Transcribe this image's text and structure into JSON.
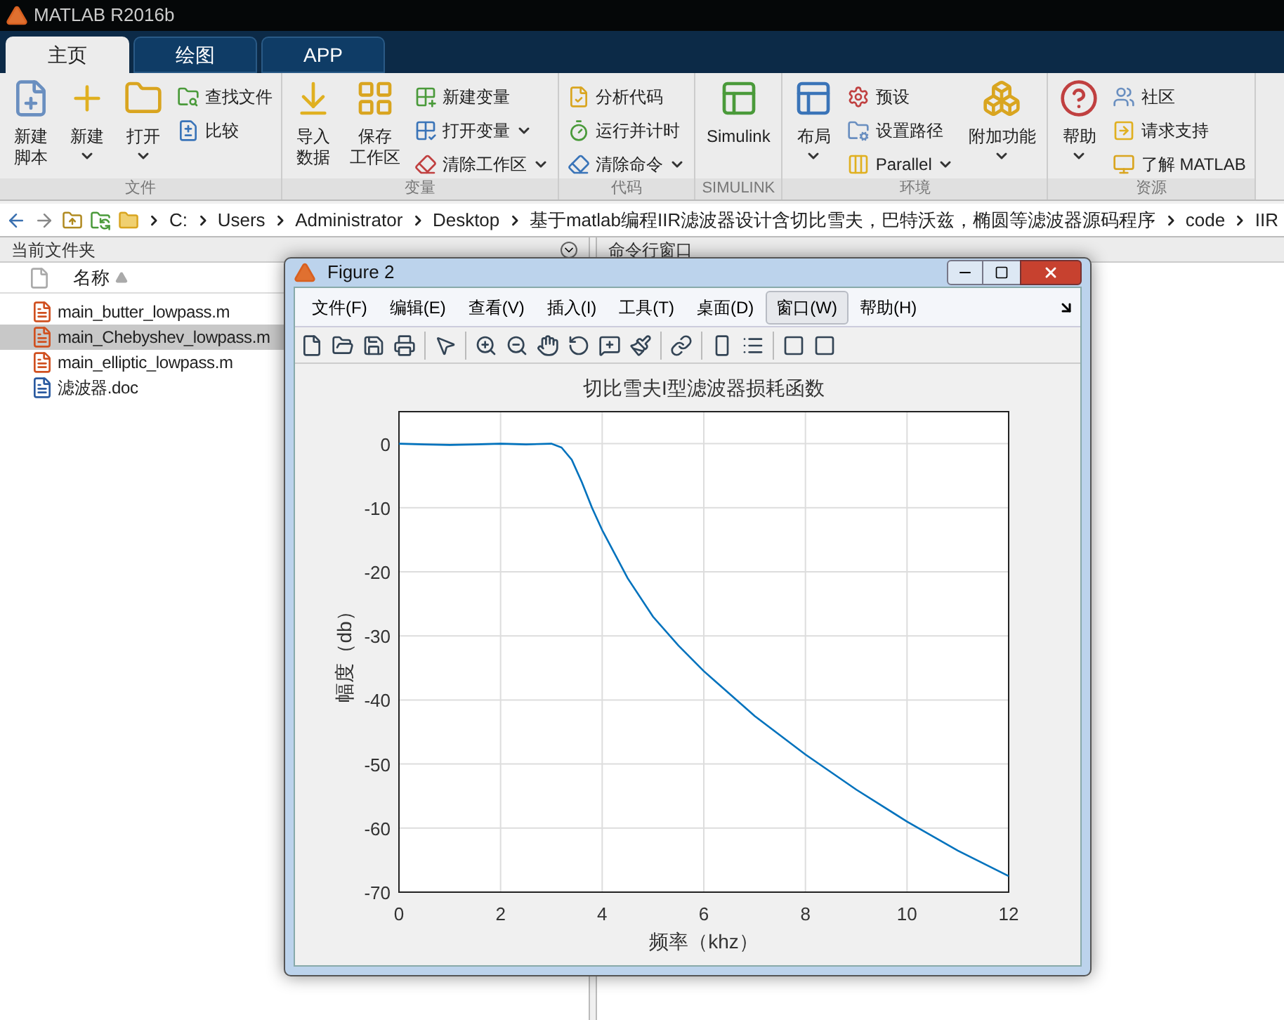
{
  "window": {
    "title": "MATLAB R2016b"
  },
  "tabs": [
    {
      "label": "主页",
      "selected": true
    },
    {
      "label": "绘图",
      "selected": false
    },
    {
      "label": "APP",
      "selected": false
    }
  ],
  "ribbon": [
    {
      "label": "文件",
      "items": [
        {
          "kind": "large",
          "lines": [
            "新建",
            "脚本"
          ],
          "dropdown": false
        },
        {
          "kind": "large",
          "label": "新建",
          "dropdown": true
        },
        {
          "kind": "large",
          "label": "打开",
          "dropdown": true
        },
        {
          "kind": "small",
          "label": "查找文件",
          "dropdown": false
        },
        {
          "kind": "small",
          "label": "比较",
          "dropdown": false
        }
      ]
    },
    {
      "label": "变量",
      "items": [
        {
          "kind": "large",
          "lines": [
            "导入",
            "数据"
          ],
          "dropdown": false
        },
        {
          "kind": "large",
          "lines": [
            "保存",
            "工作区"
          ],
          "dropdown": false
        },
        {
          "kind": "small",
          "label": "新建变量",
          "dropdown": false
        },
        {
          "kind": "small",
          "label": "打开变量",
          "dropdown": true
        },
        {
          "kind": "small",
          "label": "清除工作区",
          "dropdown": true
        }
      ]
    },
    {
      "label": "代码",
      "items": [
        {
          "kind": "small",
          "label": "分析代码",
          "dropdown": false
        },
        {
          "kind": "small",
          "label": "运行并计时",
          "dropdown": false
        },
        {
          "kind": "small",
          "label": "清除命令",
          "dropdown": true
        }
      ]
    },
    {
      "label": "SIMULINK",
      "items": [
        {
          "kind": "large",
          "label": "Simulink",
          "dropdown": false
        }
      ]
    },
    {
      "label": "环境",
      "items": [
        {
          "kind": "large",
          "label": "布局",
          "dropdown": true
        },
        {
          "kind": "small",
          "label": "预设",
          "dropdown": false
        },
        {
          "kind": "small",
          "label": "设置路径",
          "dropdown": false
        },
        {
          "kind": "small",
          "label": "Parallel",
          "dropdown": true
        },
        {
          "kind": "large",
          "label": "附加功能",
          "dropdown": true
        }
      ]
    },
    {
      "label": "资源",
      "items": [
        {
          "kind": "large",
          "label": "帮助",
          "dropdown": true
        },
        {
          "kind": "small",
          "label": "社区",
          "dropdown": false
        },
        {
          "kind": "small",
          "label": "请求支持",
          "dropdown": false
        },
        {
          "kind": "small",
          "label": "了解 MATLAB",
          "dropdown": false
        }
      ]
    }
  ],
  "path": [
    "C:",
    "Users",
    "Administrator",
    "Desktop",
    "基于matlab编程IIR滤波器设计含切比雪夫，巴特沃兹，椭圆等滤波器源码程序",
    "code",
    "IIR"
  ],
  "current_folder": {
    "title": "当前文件夹",
    "column": "名称",
    "files": [
      {
        "name": "main_butter_lowpass.m",
        "kind": "m",
        "selected": false
      },
      {
        "name": "main_Chebyshev_lowpass.m",
        "kind": "m",
        "selected": true
      },
      {
        "name": "main_elliptic_lowpass.m",
        "kind": "m",
        "selected": false
      },
      {
        "name": "滤波器.doc",
        "kind": "doc",
        "selected": false
      }
    ]
  },
  "command_window": {
    "title": "命令行窗口"
  },
  "figure": {
    "title": "Figure 2",
    "menu": [
      {
        "label": "文件(F)",
        "selected": false
      },
      {
        "label": "编辑(E)",
        "selected": false
      },
      {
        "label": "查看(V)",
        "selected": false
      },
      {
        "label": "插入(I)",
        "selected": false
      },
      {
        "label": "工具(T)",
        "selected": false
      },
      {
        "label": "桌面(D)",
        "selected": false
      },
      {
        "label": "窗口(W)",
        "selected": true
      },
      {
        "label": "帮助(H)",
        "selected": false
      }
    ],
    "chart_data": {
      "type": "line",
      "title": "切比雪夫I型滤波器损耗函数",
      "xlabel": "频率（khz）",
      "ylabel": "幅度（db）",
      "xlim": [
        0,
        12
      ],
      "ylim": [
        -70,
        5
      ],
      "xticks": [
        0,
        2,
        4,
        6,
        8,
        10,
        12
      ],
      "yticks": [
        0,
        -10,
        -20,
        -30,
        -40,
        -50,
        -60,
        -70
      ],
      "x": [
        0,
        0.5,
        1,
        1.5,
        2,
        2.5,
        3,
        3.2,
        3.4,
        3.6,
        3.8,
        4,
        4.5,
        5,
        5.5,
        6,
        7,
        8,
        9,
        10,
        11,
        12
      ],
      "grid": true,
      "series": [
        {
          "color": "#0072bd",
          "values": [
            0,
            -0.1,
            -0.2,
            -0.1,
            0,
            -0.1,
            0,
            -0.6,
            -2.5,
            -6,
            -10,
            -13.5,
            -21,
            -27,
            -31.5,
            -35.5,
            -42.5,
            -48.5,
            -54,
            -59,
            -63.5,
            -67.5
          ]
        }
      ]
    }
  }
}
